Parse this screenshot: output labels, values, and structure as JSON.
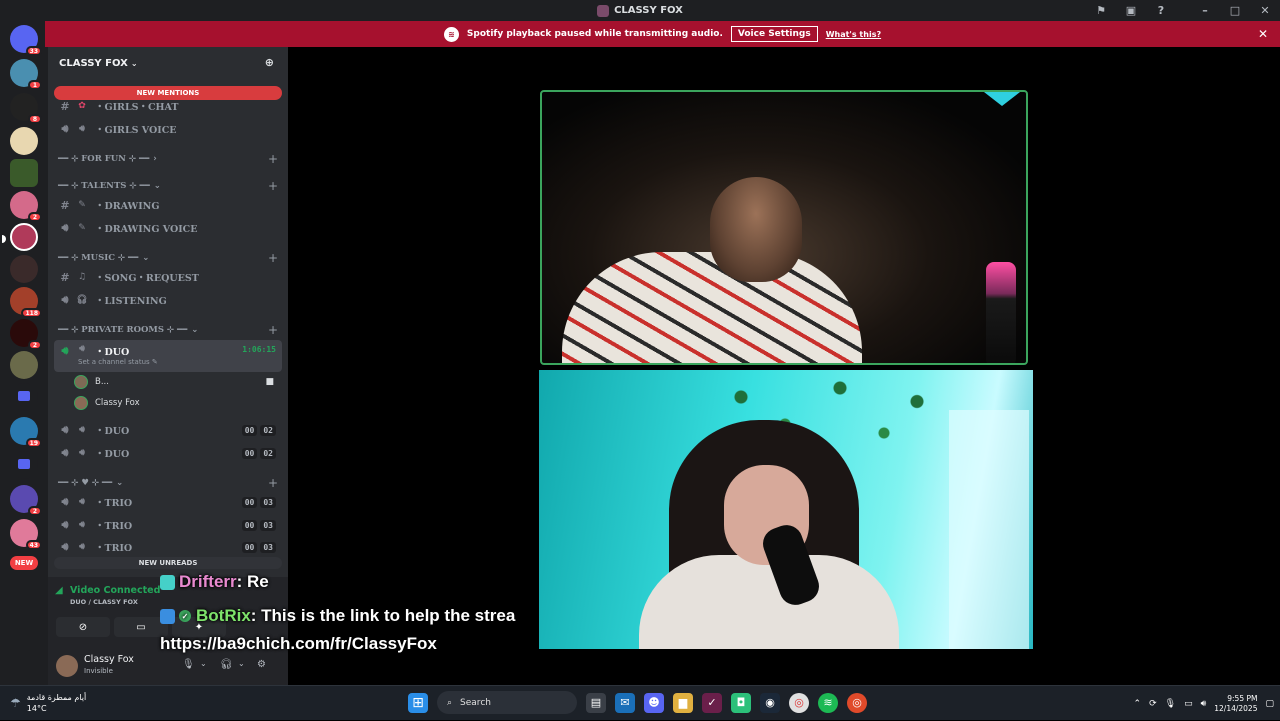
{
  "window": {
    "title": "CLASSY FOX"
  },
  "notice": {
    "text": "Spotify playback paused while transmitting audio.",
    "button_label": "Voice Settings",
    "link_label": "What's this?"
  },
  "servers": {
    "badges": [
      "33",
      "1",
      "8",
      "2",
      "118",
      "2",
      "19",
      "2",
      "43"
    ],
    "new_label": "NEW"
  },
  "guild": {
    "name": "CLASSY FOX"
  },
  "sidebar": {
    "new_mentions": "NEW MENTIONS",
    "new_unreads": "NEW UNREADS",
    "channels": {
      "girls_chat": "・GIRLS・CHAT",
      "girls_voice": "・GIRLS VOICE",
      "for_fun": "━━ ⊹ FOR FUN ⊹ ━━",
      "talents": "━━ ⊹ TALENTS ⊹ ━━",
      "drawing": "・DRAWING",
      "drawing_voice": "・DRAWING VOICE",
      "music": "━━ ⊹ MUSIC ⊹ ━━",
      "song_request": "・SONG・REQUEST",
      "listening": "・LISTENING",
      "private_rooms": "━━ ⊹ PRIVATE ROOMS ⊹ ━━",
      "duo_active": "・DUO",
      "duo_active_time": "1:06:15",
      "duo_status": "Set a channel status",
      "member_1": "B...",
      "member_2": "Classy Fox",
      "duo_2": "・DUO",
      "duo_3": "・DUO",
      "heart_cat": "━━ ⊹ ♥ ⊹ ━━",
      "trio_1": "・TRIO",
      "trio_2": "・TRIO",
      "trio_3": "・TRIO",
      "count_00": "00",
      "count_02": "02",
      "count_03": "03"
    }
  },
  "voice_panel": {
    "status": "Video Connected",
    "channel": "DUO / CLASSY FOX"
  },
  "user": {
    "name": "Classy Fox",
    "status": "Invisible"
  },
  "chat_overlay": {
    "line1_user": "Drifterr",
    "line1_text": " : Re",
    "line2_user": "BotRix",
    "line2_text": " : This is the link to help the strea",
    "line3_text": "https://ba9chich.com/fr/ClassyFox"
  },
  "taskbar": {
    "weather_text": "أيام ممطرة قادمة",
    "temp": "14°C",
    "search_placeholder": "Search",
    "time": "9:55 PM",
    "date": "12/14/2025"
  },
  "colors": {
    "accent_red": "#a6112e",
    "speaking_green": "#3ba55d",
    "sidebar_bg": "#2b2d31"
  }
}
